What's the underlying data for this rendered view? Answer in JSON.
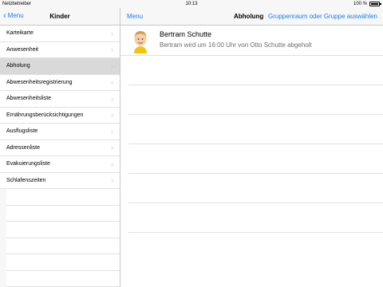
{
  "status": {
    "carrier": "Netzbetreiber",
    "time": "10:13",
    "battery": "100 %"
  },
  "sidebar": {
    "back_label": "Menu",
    "title": "Kinder",
    "items": [
      {
        "label": "Karteikarte"
      },
      {
        "label": "Anwesenheit"
      },
      {
        "label": "Abholung"
      },
      {
        "label": "Abwesenheitsregistrierung"
      },
      {
        "label": "Abwesenheitsliste"
      },
      {
        "label": "Ernährungsberücksichtigungen"
      },
      {
        "label": "Ausflugsliste"
      },
      {
        "label": "Adressenliste"
      },
      {
        "label": "Evakuierungsliste"
      },
      {
        "label": "Schlafenszeiten"
      }
    ],
    "selected_index": 2
  },
  "main": {
    "menu_label": "Menu",
    "title": "Abholung",
    "action_label": "Gruppenraum oder Gruppe auswählen",
    "entries": [
      {
        "name": "Bertram Schutte",
        "detail": "Bertram wird um 16:00 Uhr von Otto Schutte abgeholt"
      }
    ]
  },
  "colors": {
    "accent": "#1a7cf9",
    "selected_row": "#d9d9d9",
    "separator": "#e1e1e4"
  }
}
